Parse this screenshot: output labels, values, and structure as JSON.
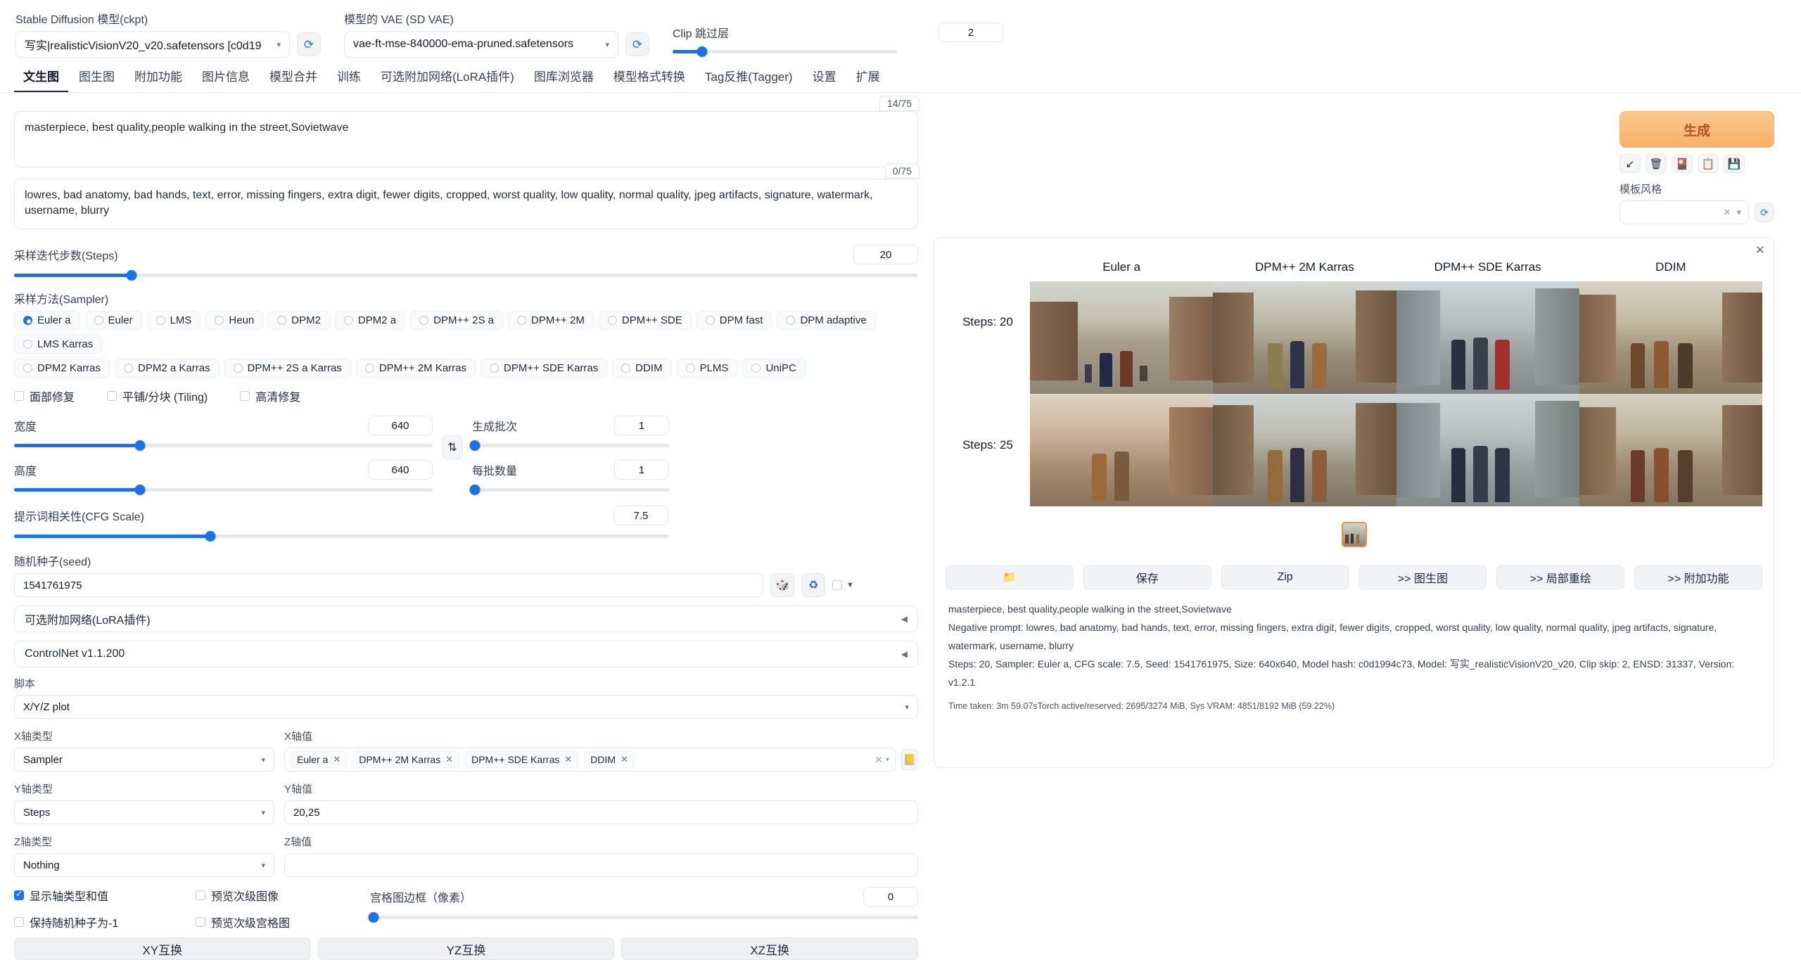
{
  "topbar": {
    "model_label": "Stable Diffusion 模型(ckpt)",
    "model_value": "写实|realisticVisionV20_v20.safetensors [c0d19",
    "vae_label": "模型的 VAE (SD VAE)",
    "vae_value": "vae-ft-mse-840000-ema-pruned.safetensors",
    "clip_label": "Clip 跳过层",
    "clip_value": "2",
    "refresh_icon": "refresh-icon"
  },
  "tabs": [
    {
      "label": "文生图",
      "active": true
    },
    {
      "label": "图生图",
      "active": false
    },
    {
      "label": "附加功能",
      "active": false
    },
    {
      "label": "图片信息",
      "active": false
    },
    {
      "label": "模型合并",
      "active": false
    },
    {
      "label": "训练",
      "active": false
    },
    {
      "label": "可选附加网络(LoRA插件)",
      "active": false
    },
    {
      "label": "图库浏览器",
      "active": false
    },
    {
      "label": "模型格式转换",
      "active": false
    },
    {
      "label": "Tag反推(Tagger)",
      "active": false
    },
    {
      "label": "设置",
      "active": false
    },
    {
      "label": "扩展",
      "active": false
    }
  ],
  "prompt": {
    "positive": "masterpiece, best quality,people walking in the street,Sovietwave",
    "positive_tokens": "14/75",
    "negative": "lowres, bad anatomy, bad hands, text, error, missing fingers, extra digit, fewer digits, cropped, worst quality, low quality, normal quality, jpeg artifacts, signature, watermark, username, blurry",
    "negative_tokens": "0/75"
  },
  "generate": {
    "label": "生成",
    "tools": [
      "arrow-down-left-icon",
      "trash-icon",
      "card-box-icon",
      "clipboard-icon",
      "floppy-disk-icon"
    ],
    "styles_label": "模板风格",
    "styles_value": "",
    "styles_clear": "✕",
    "styles_caret": "▾",
    "refresh_icon": "refresh-icon"
  },
  "settings": {
    "steps_label": "采样迭代步数(Steps)",
    "steps_value": "20",
    "steps_pct": 13,
    "sampler_label": "采样方法(Sampler)",
    "samplers_row1": [
      "Euler a",
      "Euler",
      "LMS",
      "Heun",
      "DPM2",
      "DPM2 a",
      "DPM++ 2S a",
      "DPM++ 2M",
      "DPM++ SDE",
      "DPM fast",
      "DPM adaptive",
      "LMS Karras"
    ],
    "samplers_row2": [
      "DPM2 Karras",
      "DPM2 a Karras",
      "DPM++ 2S a Karras",
      "DPM++ 2M Karras",
      "DPM++ SDE Karras",
      "DDIM",
      "PLMS",
      "UniPC"
    ],
    "sampler_selected": "Euler a",
    "checkboxes": [
      {
        "label": "面部修复",
        "checked": false
      },
      {
        "label": "平铺/分块 (Tiling)",
        "checked": false
      },
      {
        "label": "高清修复",
        "checked": false
      }
    ],
    "width_label": "宽度",
    "width_value": "640",
    "width_pct": 30,
    "height_label": "高度",
    "height_value": "640",
    "height_pct": 30,
    "swap_icon": "swap-vertical-icon",
    "batch_count_label": "生成批次",
    "batch_count_value": "1",
    "batch_count_pct": 1,
    "batch_size_label": "每批数量",
    "batch_size_value": "1",
    "batch_size_pct": 1,
    "cfg_label": "提示词相关性(CFG Scale)",
    "cfg_value": "7.5",
    "cfg_pct": 30,
    "seed_label": "随机种子(seed)",
    "seed_value": "1541761975",
    "seed_dice_icon": "dice-icon",
    "seed_recycle_icon": "recycle-icon",
    "seed_extra_checkbox": false,
    "seed_caret": "▾"
  },
  "accordions": [
    {
      "label": "可选附加网络(LoRA插件)",
      "arrow": "◀"
    },
    {
      "label": "ControlNet v1.1.200",
      "arrow": "◀"
    }
  ],
  "script": {
    "label": "脚本",
    "value": "X/Y/Z plot",
    "caret": "▾"
  },
  "xyz": {
    "x_type_label": "X轴类型",
    "x_type_value": "Sampler",
    "x_values_label": "X轴值",
    "x_values": [
      "Euler a",
      "DPM++ 2M Karras",
      "DPM++ SDE Karras",
      "DDIM"
    ],
    "x_clear": "✕",
    "fill_icon": "fill-list-icon",
    "y_type_label": "Y轴类型",
    "y_type_value": "Steps",
    "y_values_label": "Y轴值",
    "y_values": "20,25",
    "z_type_label": "Z轴类型",
    "z_type_value": "Nothing",
    "z_values_label": "Z轴值",
    "z_values": "",
    "opt_show_axis": {
      "label": "显示轴类型和值",
      "checked": true
    },
    "opt_preview_sub": {
      "label": "预览次级图像",
      "checked": false
    },
    "opt_keep_seed": {
      "label": "保持随机种子为-1",
      "checked": false
    },
    "opt_preview_grid": {
      "label": "预览次级宫格图",
      "checked": false
    },
    "margin_label": "宫格图边框（像素）",
    "margin_value": "0",
    "margin_pct": 0,
    "swap_xy": "XY互换",
    "swap_yz": "YZ互换",
    "swap_xz": "XZ互换"
  },
  "result": {
    "close_icon": "close-icon",
    "col_labels": [
      "Euler a",
      "DPM++ 2M Karras",
      "DPM++ SDE Karras",
      "DDIM"
    ],
    "row_labels": [
      "Steps: 20",
      "Steps: 25"
    ],
    "actions": [
      "folder-icon",
      "保存",
      "Zip",
      ">> 图生图",
      ">> 局部重绘",
      ">> 附加功能"
    ],
    "info_prompt": "masterpiece, best quality,people walking in the street,Sovietwave",
    "info_negative": "Negative prompt: lowres, bad anatomy, bad hands, text, error, missing fingers, extra digit, fewer digits, cropped, worst quality, low quality, normal quality, jpeg artifacts, signature, watermark, username, blurry",
    "info_params": "Steps: 20, Sampler: Euler a, CFG scale: 7.5, Seed: 1541761975, Size: 640x640, Model hash: c0d1994c73, Model: 写实_realisticVisionV20_v20, Clip skip: 2, ENSD: 31337, Version: v1.2.1",
    "info_time": "Time taken: 3m 59.07sTorch active/reserved: 2695/3274 MiB, Sys VRAM: 4851/8192 MiB (59.22%)"
  },
  "chart_data": {
    "type": "table",
    "title": "X/Y/Z plot grid",
    "xlabel": "Sampler",
    "ylabel": "Steps",
    "categories": [
      "Euler a",
      "DPM++ 2M Karras",
      "DPM++ SDE Karras",
      "DDIM"
    ],
    "rows": [
      "Steps: 20",
      "Steps: 25"
    ],
    "cells": [
      [
        "image",
        "image",
        "image",
        "image"
      ],
      [
        "image",
        "image",
        "image",
        "image"
      ]
    ]
  },
  "footer": ""
}
